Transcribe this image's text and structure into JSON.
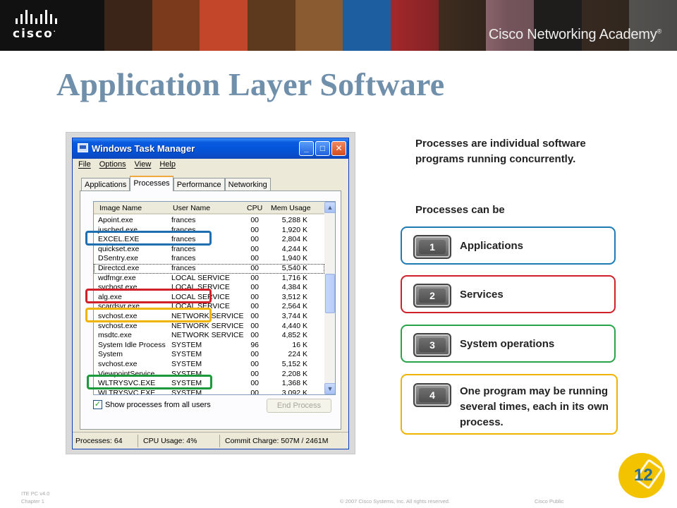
{
  "banner": {
    "logo_word": "cisco",
    "academy_text": "Cisco Networking Academy",
    "academy_mark": "®",
    "photo_colors": [
      "#3b2418",
      "#7a3a1b",
      "#c4462a",
      "#5d3a1e",
      "#8a5a31",
      "#1d5ea0",
      "#a1272a",
      "#4a3322",
      "#e7a3b0",
      "#2e2a28",
      "#6b4b33",
      "#cfcac2"
    ]
  },
  "slide": {
    "title": "Application Layer Software"
  },
  "task_manager": {
    "window_title": "Windows Task Manager",
    "menu": [
      "File",
      "Options",
      "View",
      "Help"
    ],
    "tabs": [
      "Applications",
      "Processes",
      "Performance",
      "Networking"
    ],
    "active_tab": "Processes",
    "columns": [
      "Image Name",
      "User Name",
      "CPU",
      "Mem Usage"
    ],
    "rows": [
      [
        "Apoint.exe",
        "frances",
        "00",
        "5,288 K"
      ],
      [
        "jusched.exe",
        "frances",
        "00",
        "1,920 K"
      ],
      [
        "EXCEL.EXE",
        "frances",
        "00",
        "2,804 K"
      ],
      [
        "quickset.exe",
        "frances",
        "00",
        "4,244 K"
      ],
      [
        "DSentry.exe",
        "frances",
        "00",
        "1,940 K"
      ],
      [
        "Directcd.exe",
        "frances",
        "00",
        "5,540 K"
      ],
      [
        "wdfmgr.exe",
        "LOCAL SERVICE",
        "00",
        "1,716 K"
      ],
      [
        "svchost.exe",
        "LOCAL SERVICE",
        "00",
        "4,384 K"
      ],
      [
        "alg.exe",
        "LOCAL SERVICE",
        "00",
        "3,512 K"
      ],
      [
        "scardsvr.exe",
        "LOCAL SERVICE",
        "00",
        "2,564 K"
      ],
      [
        "svchost.exe",
        "NETWORK SERVICE",
        "00",
        "3,744 K"
      ],
      [
        "svchost.exe",
        "NETWORK SERVICE",
        "00",
        "4,440 K"
      ],
      [
        "msdtc.exe",
        "NETWORK SERVICE",
        "00",
        "4,852 K"
      ],
      [
        "System Idle Process",
        "SYSTEM",
        "96",
        "16 K"
      ],
      [
        "System",
        "SYSTEM",
        "00",
        "224 K"
      ],
      [
        "svchost.exe",
        "SYSTEM",
        "00",
        "5,152 K"
      ],
      [
        "ViewpointService....",
        "SYSTEM",
        "00",
        "2,208 K"
      ],
      [
        "WLTRYSVC.EXE",
        "SYSTEM",
        "00",
        "1,368 K"
      ],
      [
        "WLTRYSVC.EXE",
        "SYSTEM",
        "00",
        "3,092 K"
      ]
    ],
    "selected_row": 5,
    "show_all_label": "Show processes from all users",
    "show_all_checked": true,
    "end_process_label": "End Process",
    "status": {
      "processes": "Processes: 64",
      "cpu": "CPU Usage: 4%",
      "commit": "Commit Charge: 507M / 2461M"
    }
  },
  "highlights": [
    {
      "color": "#1f6fb0",
      "row": 2
    },
    {
      "color": "#d0202a",
      "row": 8
    },
    {
      "color": "#f0b400",
      "row": 10
    },
    {
      "color": "#1a9a3a",
      "row": 17
    }
  ],
  "right": {
    "description": "Processes are individual software programs running concurrently.",
    "can_be": "Processes can be",
    "items": [
      {
        "number": "1",
        "label": "Applications",
        "color": "#1f7bb8"
      },
      {
        "number": "2",
        "label": "Services",
        "color": "#d0202a"
      },
      {
        "number": "3",
        "label": "System operations",
        "color": "#2aa44a"
      },
      {
        "number": "4",
        "label": "One program may be running several times, each in its own process.",
        "color": "#f0b400"
      }
    ]
  },
  "footer": {
    "course": "ITE PC v4.0",
    "chapter": "Chapter 1",
    "copyright": "© 2007 Cisco Systems, Inc. All rights reserved.",
    "classification": "Cisco Public",
    "page_number": "12"
  }
}
